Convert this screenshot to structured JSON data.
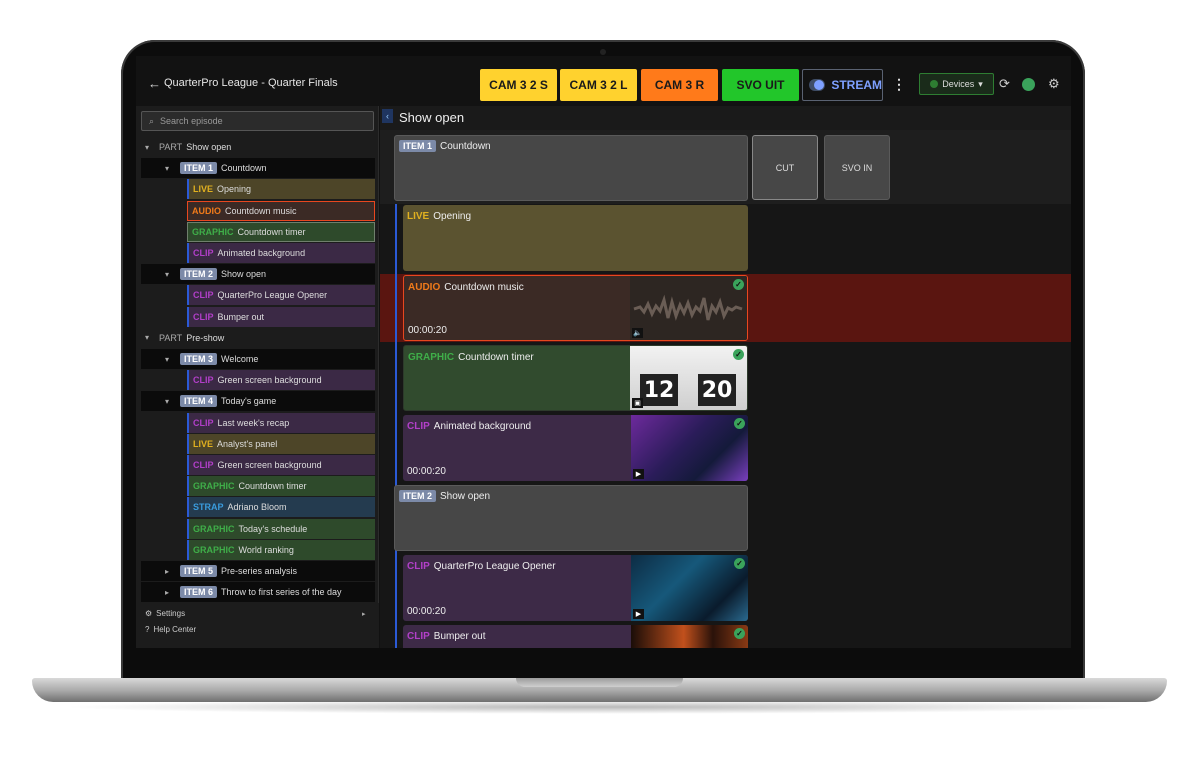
{
  "header": {
    "title": "QuarterPro League - Quarter Finals",
    "sources": [
      {
        "label": "CAM 3 2 S",
        "color": "#ffd22e"
      },
      {
        "label": "CAM 3 2 L",
        "color": "#ffd22e"
      },
      {
        "label": "CAM 3 R",
        "color": "#ff7a1a"
      },
      {
        "label": "SVO UIT",
        "color": "#22c62a"
      }
    ],
    "stream_label": "STREAM",
    "devices_label": "Devices"
  },
  "sidebar": {
    "search_placeholder": "Search episode",
    "part_prefix": "PART",
    "tree": [
      {
        "kind": "part",
        "label": "Show open"
      },
      {
        "kind": "item",
        "tag": "ITEM 1",
        "label": "Countdown"
      },
      {
        "kind": "child",
        "tag": "LIVE",
        "label": "Opening"
      },
      {
        "kind": "child",
        "tag": "AUDIO",
        "label": "Countdown music"
      },
      {
        "kind": "child",
        "tag": "GRAPHIC",
        "label": "Countdown timer"
      },
      {
        "kind": "child",
        "tag": "CLIP",
        "label": "Animated background"
      },
      {
        "kind": "item",
        "tag": "ITEM 2",
        "label": "Show open"
      },
      {
        "kind": "child",
        "tag": "CLIP",
        "label": "QuarterPro League Opener"
      },
      {
        "kind": "child",
        "tag": "CLIP",
        "label": "Bumper out"
      },
      {
        "kind": "part",
        "label": "Pre-show"
      },
      {
        "kind": "item",
        "tag": "ITEM 3",
        "label": "Welcome"
      },
      {
        "kind": "child",
        "tag": "CLIP",
        "label": "Green screen background"
      },
      {
        "kind": "item",
        "tag": "ITEM 4",
        "label": "Today's game"
      },
      {
        "kind": "child",
        "tag": "CLIP",
        "label": "Last week's recap"
      },
      {
        "kind": "child",
        "tag": "LIVE",
        "label": "Analyst's panel"
      },
      {
        "kind": "child",
        "tag": "CLIP",
        "label": "Green screen background"
      },
      {
        "kind": "child",
        "tag": "GRAPHIC",
        "label": "Countdown timer"
      },
      {
        "kind": "child",
        "tag": "STRAP",
        "label": "Adriano Bloom"
      },
      {
        "kind": "child",
        "tag": "GRAPHIC",
        "label": "Today's schedule"
      },
      {
        "kind": "child",
        "tag": "GRAPHIC",
        "label": "World ranking"
      },
      {
        "kind": "item",
        "tag": "ITEM 5",
        "label": "Pre-series analysis"
      },
      {
        "kind": "item",
        "tag": "ITEM 6",
        "label": "Throw to first series of the day"
      }
    ],
    "footer": {
      "settings": "Settings",
      "help": "Help Center"
    }
  },
  "main": {
    "title": "Show open",
    "item1": {
      "tag": "ITEM 1",
      "label": "Countdown"
    },
    "cut_label": "CUT",
    "svo_in_label": "SVO IN",
    "item2": {
      "tag": "ITEM 2",
      "label": "Show open"
    },
    "clips": [
      {
        "tag": "LIVE",
        "label": "Opening",
        "duration": ""
      },
      {
        "tag": "AUDIO",
        "label": "Countdown music",
        "duration": "00:00:20"
      },
      {
        "tag": "GRAPHIC",
        "label": "Countdown timer",
        "duration": "",
        "clock_h": "12",
        "clock_m": "20"
      },
      {
        "tag": "CLIP",
        "label": "Animated background",
        "duration": "00:00:20"
      },
      {
        "tag": "CLIP",
        "label": "QuarterPro League Opener",
        "duration": "00:00:20"
      },
      {
        "tag": "CLIP",
        "label": "Bumper out",
        "duration": ""
      }
    ]
  },
  "colors": {
    "live": "#e0b020",
    "audio": "#f07a1a",
    "graphic": "#3fae49",
    "clip": "#b23fc9",
    "strap": "#3a9bdc"
  }
}
